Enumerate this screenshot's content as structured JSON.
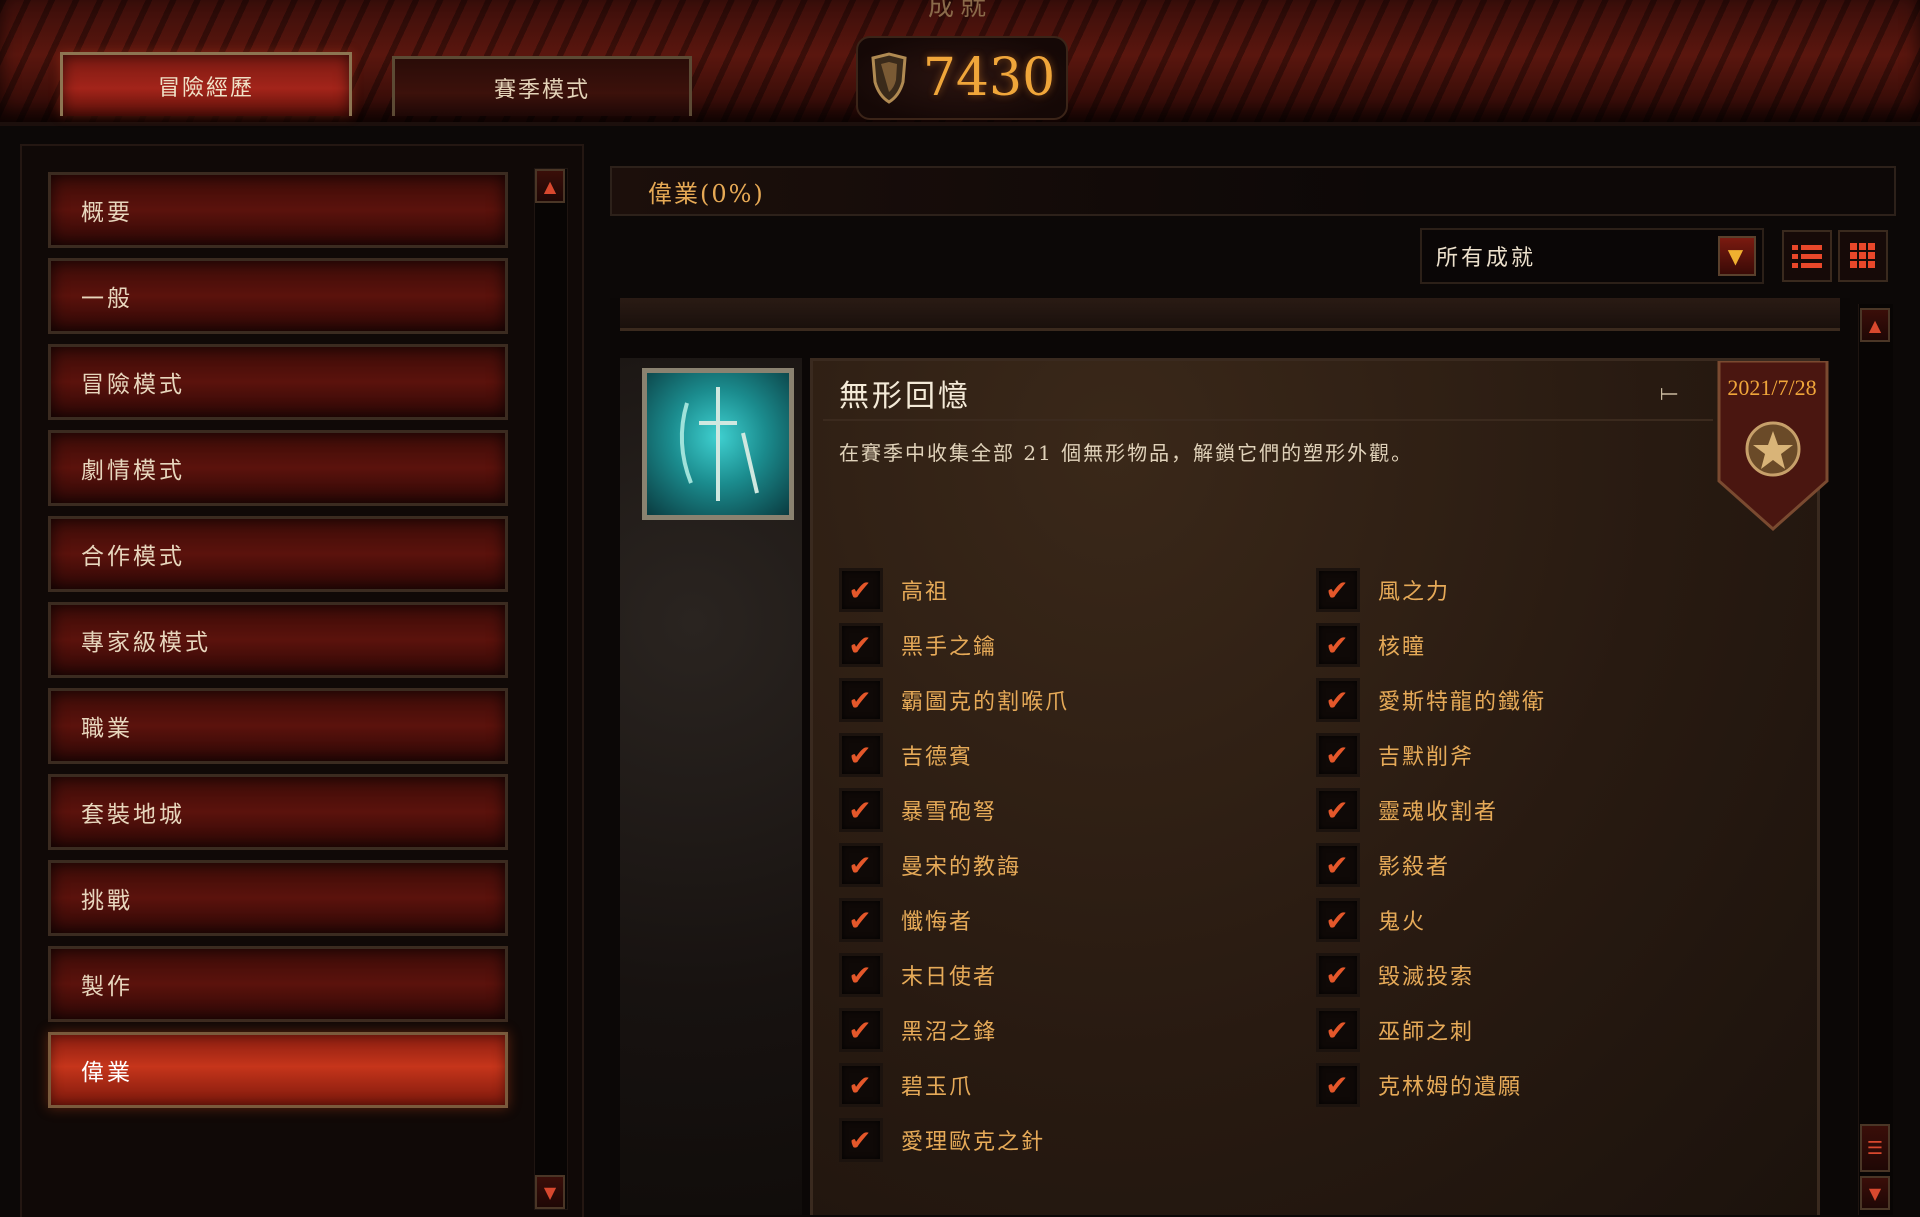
{
  "window": {
    "title": "成就"
  },
  "tabs": [
    {
      "label": "冒險經歷",
      "active": true
    },
    {
      "label": "賽季模式",
      "active": false
    }
  ],
  "score": {
    "value": "7430",
    "icon": "shield-icon"
  },
  "nav": {
    "items": [
      {
        "label": "概要"
      },
      {
        "label": "一般"
      },
      {
        "label": "冒險模式"
      },
      {
        "label": "劇情模式"
      },
      {
        "label": "合作模式"
      },
      {
        "label": "專家級模式"
      },
      {
        "label": "職業"
      },
      {
        "label": "套裝地城"
      },
      {
        "label": "挑戰"
      },
      {
        "label": "製作"
      },
      {
        "label": "偉業",
        "selected": true
      }
    ]
  },
  "section": {
    "header": "偉業(0%)"
  },
  "filter": {
    "selected": "所有成就",
    "arrow_icon": "chevron-down-icon"
  },
  "view_buttons": {
    "list_icon": "list-view-icon",
    "grid_icon": "grid-view-icon"
  },
  "achievement": {
    "title": "無形回憶",
    "date": "2021/7/28",
    "description": "在賽季中收集全部 21 個無形物品，解鎖它們的塑形外觀。",
    "pin_icon": "pin-icon",
    "left_items": [
      {
        "label": "高祖",
        "checked": true
      },
      {
        "label": "黑手之鑰",
        "checked": true
      },
      {
        "label": "霸圖克的割喉爪",
        "checked": true
      },
      {
        "label": "吉德賓",
        "checked": true
      },
      {
        "label": "暴雪砲弩",
        "checked": true
      },
      {
        "label": "曼宋的教誨",
        "checked": true
      },
      {
        "label": "懺悔者",
        "checked": true
      },
      {
        "label": "末日使者",
        "checked": true
      },
      {
        "label": "黑沼之鋒",
        "checked": true
      },
      {
        "label": "碧玉爪",
        "checked": true
      },
      {
        "label": "愛理歐克之針",
        "checked": true
      }
    ],
    "right_items": [
      {
        "label": "風之力",
        "checked": true
      },
      {
        "label": "核瞳",
        "checked": true
      },
      {
        "label": "愛斯特龍的鐵衛",
        "checked": true
      },
      {
        "label": "吉默削斧",
        "checked": true
      },
      {
        "label": "靈魂收割者",
        "checked": true
      },
      {
        "label": "影殺者",
        "checked": true
      },
      {
        "label": "鬼火",
        "checked": true
      },
      {
        "label": "毀滅投索",
        "checked": true
      },
      {
        "label": "巫師之刺",
        "checked": true
      },
      {
        "label": "克林姆的遺願",
        "checked": true
      }
    ],
    "check_glyph": "✔"
  },
  "colors": {
    "accent_gold": "#f0a63a",
    "nav_red": "#5b120c",
    "nav_selected": "#c6351b",
    "check_red": "#e4572a"
  }
}
